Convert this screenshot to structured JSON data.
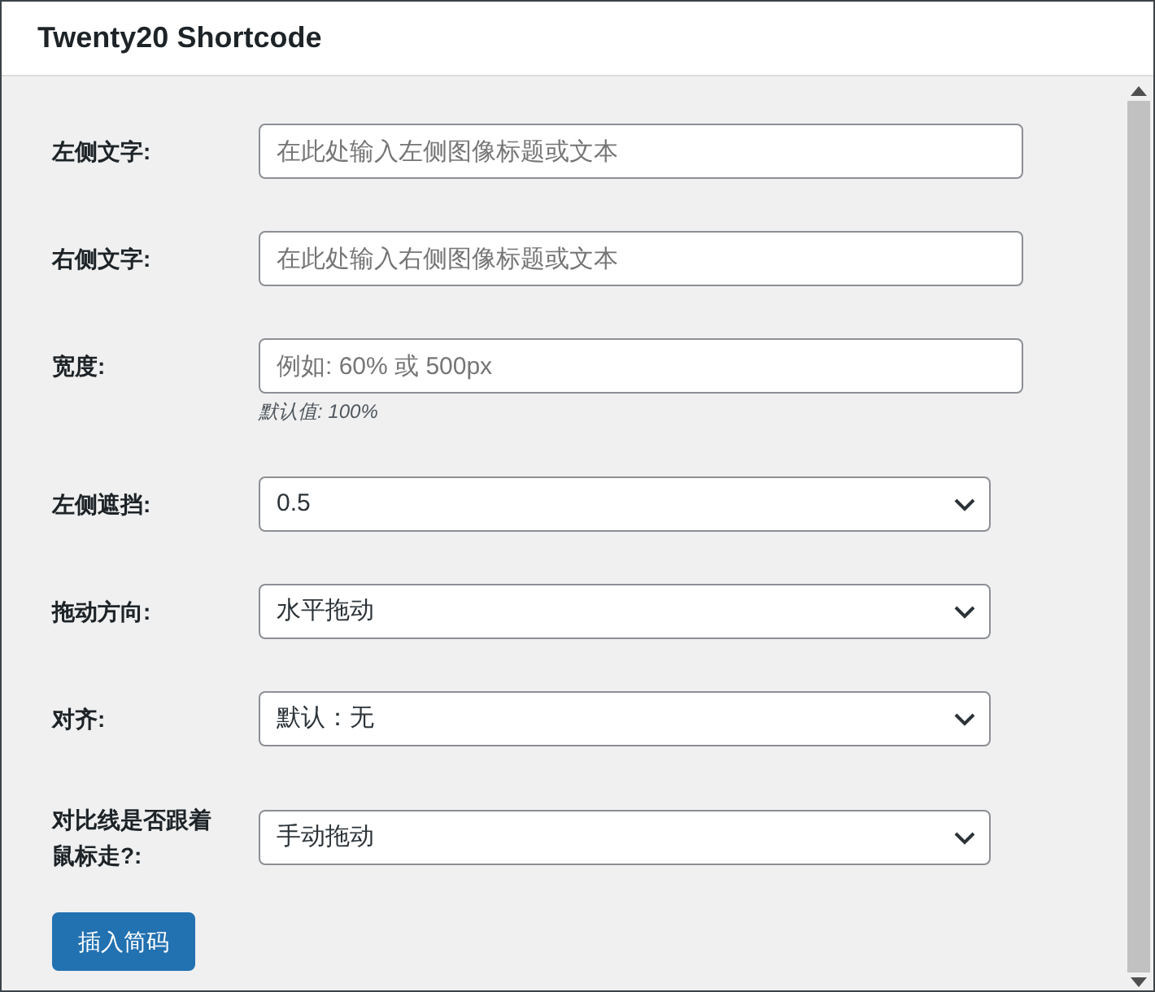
{
  "window": {
    "title": "Twenty20 Shortcode"
  },
  "fields": [
    {
      "kind": "text",
      "label": "左侧文字:",
      "placeholder": "在此处输入左侧图像标题或文本"
    },
    {
      "kind": "text",
      "label": "右侧文字:",
      "placeholder": "在此处输入右侧图像标题或文本"
    },
    {
      "kind": "text",
      "label": "宽度:",
      "placeholder": "例如: 60% 或 500px",
      "hint": "默认值: 100%"
    },
    {
      "kind": "select",
      "label": "左侧遮挡:",
      "value": "0.5"
    },
    {
      "kind": "select",
      "label": "拖动方向:",
      "value": "水平拖动"
    },
    {
      "kind": "select",
      "label": "对齐:",
      "value": "默认：无"
    },
    {
      "kind": "select",
      "label": "对比线是否跟着鼠标走?:",
      "value": "手动拖动"
    }
  ],
  "button": {
    "label": "插入简码"
  }
}
